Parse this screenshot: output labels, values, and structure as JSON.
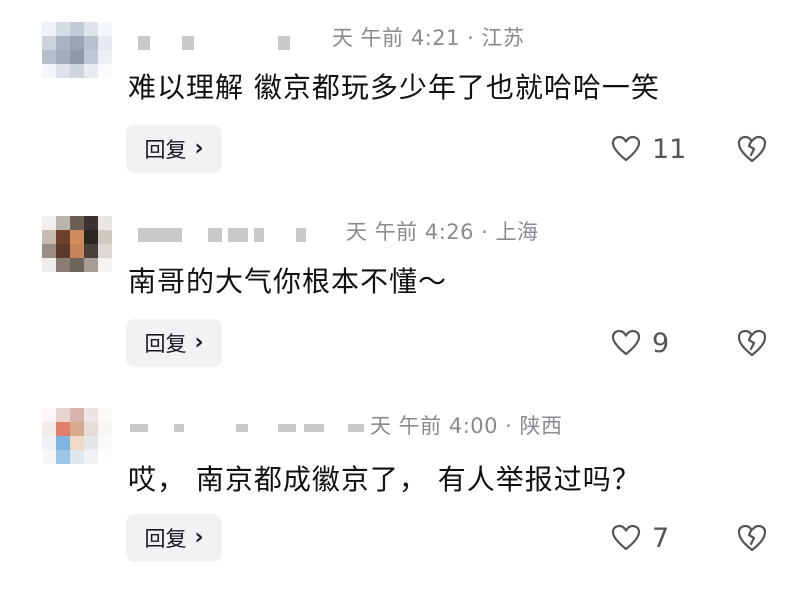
{
  "comments": [
    {
      "meta": "天 午前 4:21 · 江苏",
      "text": "难以理解 徽京都玩多少年了也就哈哈一笑",
      "reply_label": "回复",
      "likes": "11"
    },
    {
      "meta": "天 午前 4:26 · 上海",
      "text": "南哥的大气你根本不懂～",
      "reply_label": "回复",
      "likes": "9"
    },
    {
      "meta": "天 午前 4:00 · 陕西",
      "text": "哎， 南京都成徽京了， 有人举报过吗？",
      "reply_label": "回复",
      "likes": "7"
    }
  ],
  "icons": {
    "reply_chevron": "chevron-right-icon",
    "like": "heart-outline-icon",
    "dislike": "broken-heart-icon"
  },
  "colors": {
    "text": "#111111",
    "meta": "#8a8b91",
    "reply_bg": "#f2f2f4",
    "icon": "#545559"
  }
}
